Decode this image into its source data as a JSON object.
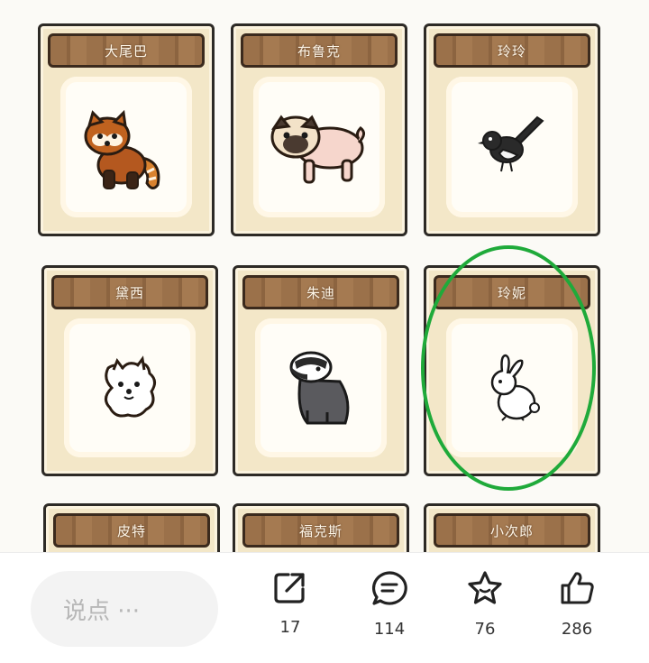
{
  "grid": {
    "cards": [
      {
        "name": "大尾巴",
        "animal": "red-panda"
      },
      {
        "name": "布鲁克",
        "animal": "pug"
      },
      {
        "name": "玲玲",
        "animal": "magpie"
      },
      {
        "name": "黛西",
        "animal": "pomeranian"
      },
      {
        "name": "朱迪",
        "animal": "badger"
      },
      {
        "name": "玲妮",
        "animal": "rabbit"
      },
      {
        "name": "皮特",
        "animal": ""
      },
      {
        "name": "福克斯",
        "animal": ""
      },
      {
        "name": "小次郎",
        "animal": ""
      }
    ],
    "highlight_color": "#1faa3a"
  },
  "bottom_bar": {
    "comment_placeholder": "说点 ···",
    "share_count": "17",
    "comment_count": "114",
    "favorite_count": "76",
    "like_count": "286"
  }
}
